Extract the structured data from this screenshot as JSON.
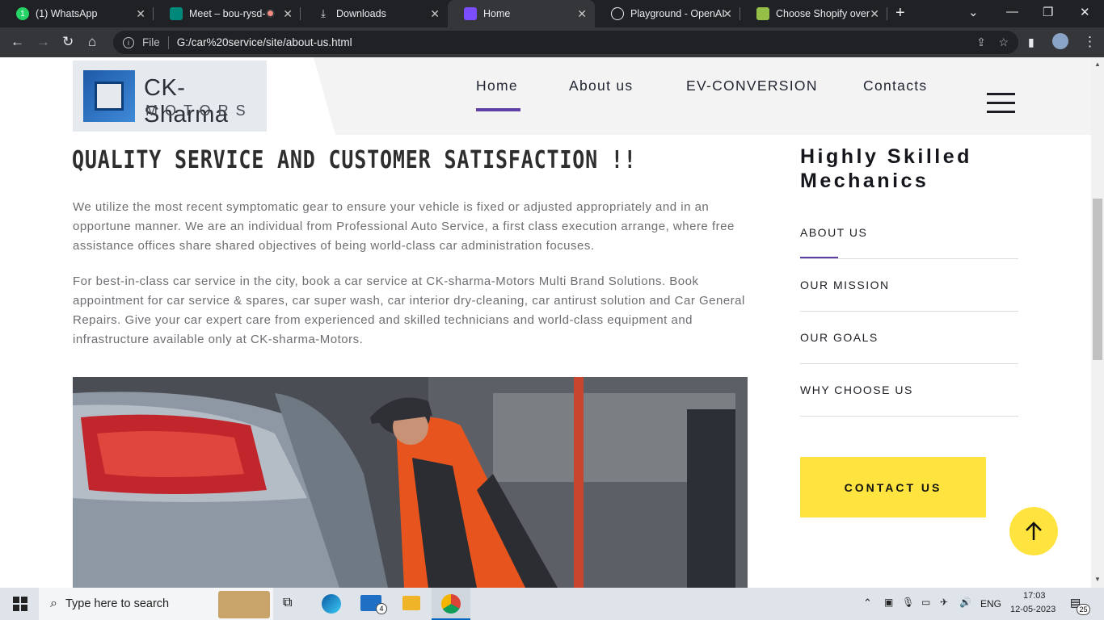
{
  "browser": {
    "tabs": [
      {
        "title": "(1) WhatsApp",
        "icon": "whatsapp-icon",
        "color": "#25d366"
      },
      {
        "title": "Meet – bou-rysd-",
        "icon": "meet-icon",
        "color": "#00897b"
      },
      {
        "title": "Downloads",
        "icon": "download-icon",
        "color": "#e8eaed"
      },
      {
        "title": "Home",
        "icon": "vs-icon",
        "color": "#7c4dff"
      },
      {
        "title": "Playground - OpenAI",
        "icon": "openai-icon",
        "color": "#e8eaed"
      },
      {
        "title": "Choose Shopify over",
        "icon": "shopify-icon",
        "color": "#95bf47"
      }
    ],
    "url_prefix": "File",
    "url": "G:/car%20service/site/about-us.html"
  },
  "site": {
    "logo_title": "CK-Sharma",
    "logo_sub": "MOTORS",
    "nav": [
      "Home",
      "About us",
      "EV-CONVERSION",
      "Contacts"
    ],
    "active_nav": "Home",
    "accent": "#5e3fa5",
    "button_color": "#ffe43f"
  },
  "content": {
    "title": "QUALITY SERVICE AND CUSTOMER SATISFACTION !!",
    "para1": "We utilize the most recent symptomatic gear to ensure your vehicle is fixed or adjusted appropriately and in an opportune manner. We are an individual from Professional Auto Service, a first class execution arrange, where free assistance offices share shared objectives of being world-class car administration focuses.",
    "para2": "For best-in-class car service in the city, book a car service at CK-sharma-Motors Multi Brand Solutions. Book appointment for car service & spares, car super wash, car interior dry-cleaning, car antirust solution and Car General Repairs. Give your car expert care from experienced and skilled technicians and world-class equipment and infrastructure available only at CK-sharma-Motors."
  },
  "sidebar": {
    "title_line1": "Highly Skilled",
    "title_line2": "Mechanics",
    "links": [
      "ABOUT US",
      "OUR MISSION",
      "OUR GOALS",
      "WHY CHOOSE US"
    ],
    "contact_label": "CONTACT US"
  },
  "taskbar": {
    "search_placeholder": "Type here to search",
    "lang": "ENG",
    "time": "17:03",
    "date": "12-05-2023",
    "mail_badge": "4",
    "notif_badge": "25"
  }
}
